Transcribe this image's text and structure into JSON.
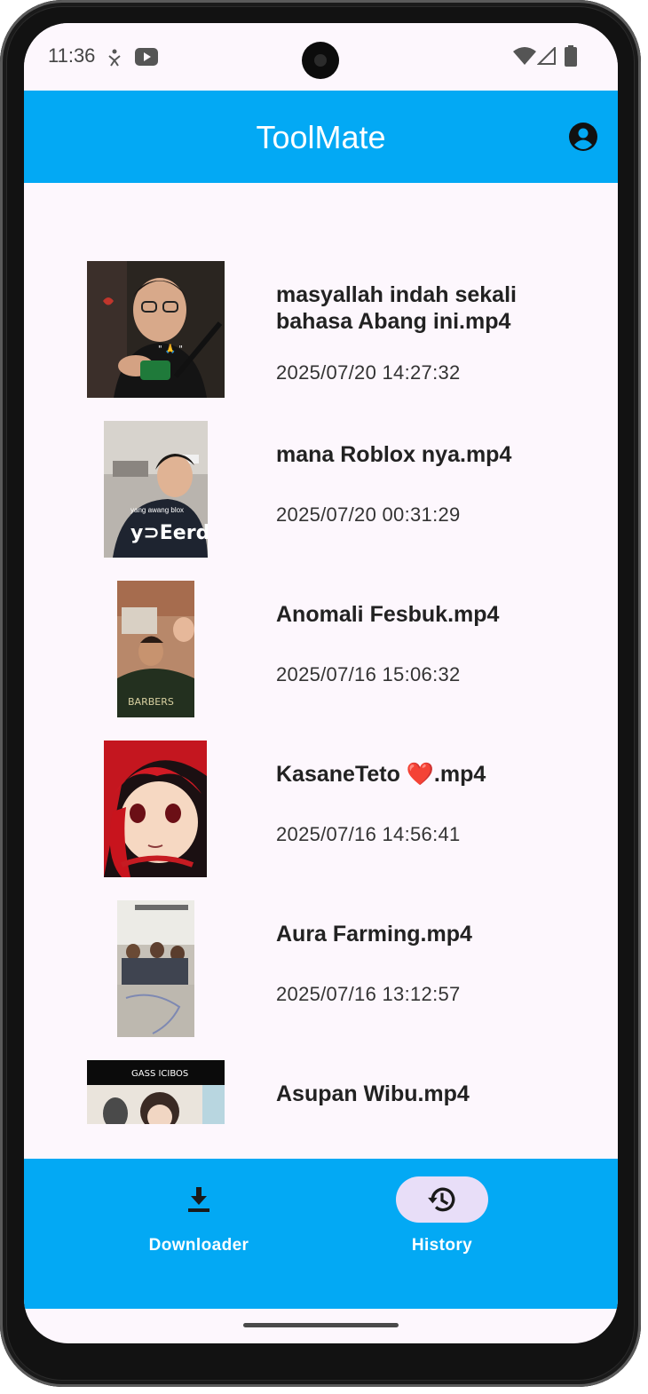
{
  "status": {
    "time": "11:36"
  },
  "app": {
    "title": "ToolMate"
  },
  "history": [
    {
      "title": "masyallah indah sekali bahasa Abang ini.mp4",
      "date": "2025/07/20 14:27:32"
    },
    {
      "title": "mana Roblox nya.mp4",
      "date": "2025/07/20 00:31:29"
    },
    {
      "title": "Anomali Fesbuk.mp4",
      "date": "2025/07/16 15:06:32"
    },
    {
      "title": "KasaneTeto ❤️.mp4",
      "date": "2025/07/16 14:56:41"
    },
    {
      "title": "Aura Farming.mp4",
      "date": "2025/07/16 13:12:57"
    },
    {
      "title": "Asupan Wibu.mp4",
      "date": ""
    }
  ],
  "thumb_text": {
    "roblox": "yang awang blox",
    "wibu": "GASS ICIBOS"
  },
  "nav": {
    "downloader": "Downloader",
    "history": "History"
  },
  "colors": {
    "accent": "#03a9f4",
    "background": "#fdf7fd",
    "active_pill": "#e8def8"
  }
}
